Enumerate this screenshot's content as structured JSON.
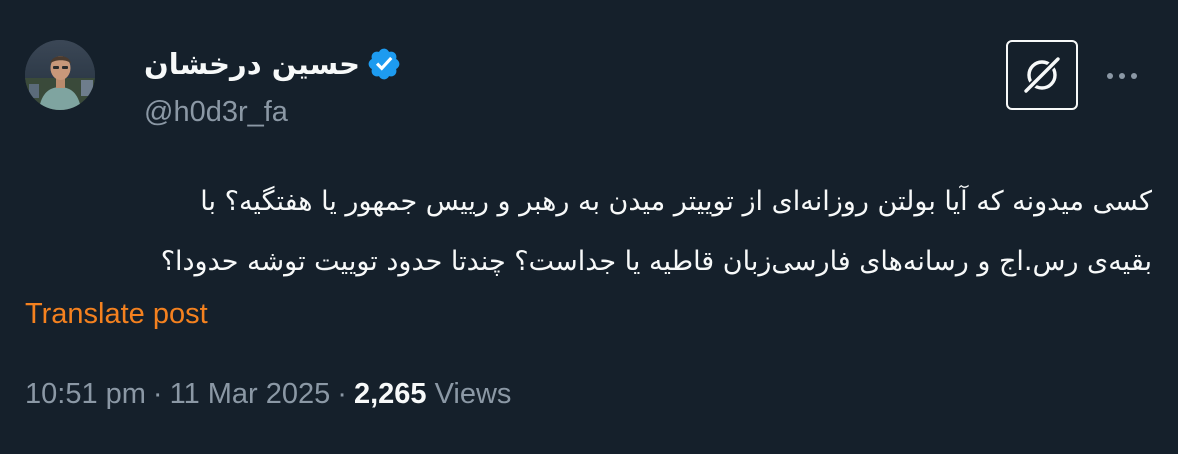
{
  "author": {
    "display_name": "حسین درخشان",
    "handle": "@h0d3r_fa",
    "verified": true
  },
  "post": {
    "lines": [
      "کسی میدونه که آیا بولتن روزانه‌ای از توییتر میدن به رهبر و رییس جمهور یا هفتگیه؟ با",
      "بقیه‌ی رس.اج  و رسانه‌های فارسی‌زبان قاطیه یا جداست؟ چندتا حدود توییت توشه حدودا؟"
    ],
    "translate_label": "Translate post"
  },
  "meta": {
    "time": "10:51 pm",
    "separator": "·",
    "date": "11 Mar 2025",
    "views_count": "2,265",
    "views_label": "Views"
  },
  "icons": {
    "verified": "verified-badge-icon",
    "grok": "grok-icon",
    "more": "more-options-icon"
  },
  "colors": {
    "background": "#15202b",
    "text": "#f7f9f9",
    "secondary": "#8b98a5",
    "verified": "#1d9bf0",
    "translate": "#f4811f"
  }
}
